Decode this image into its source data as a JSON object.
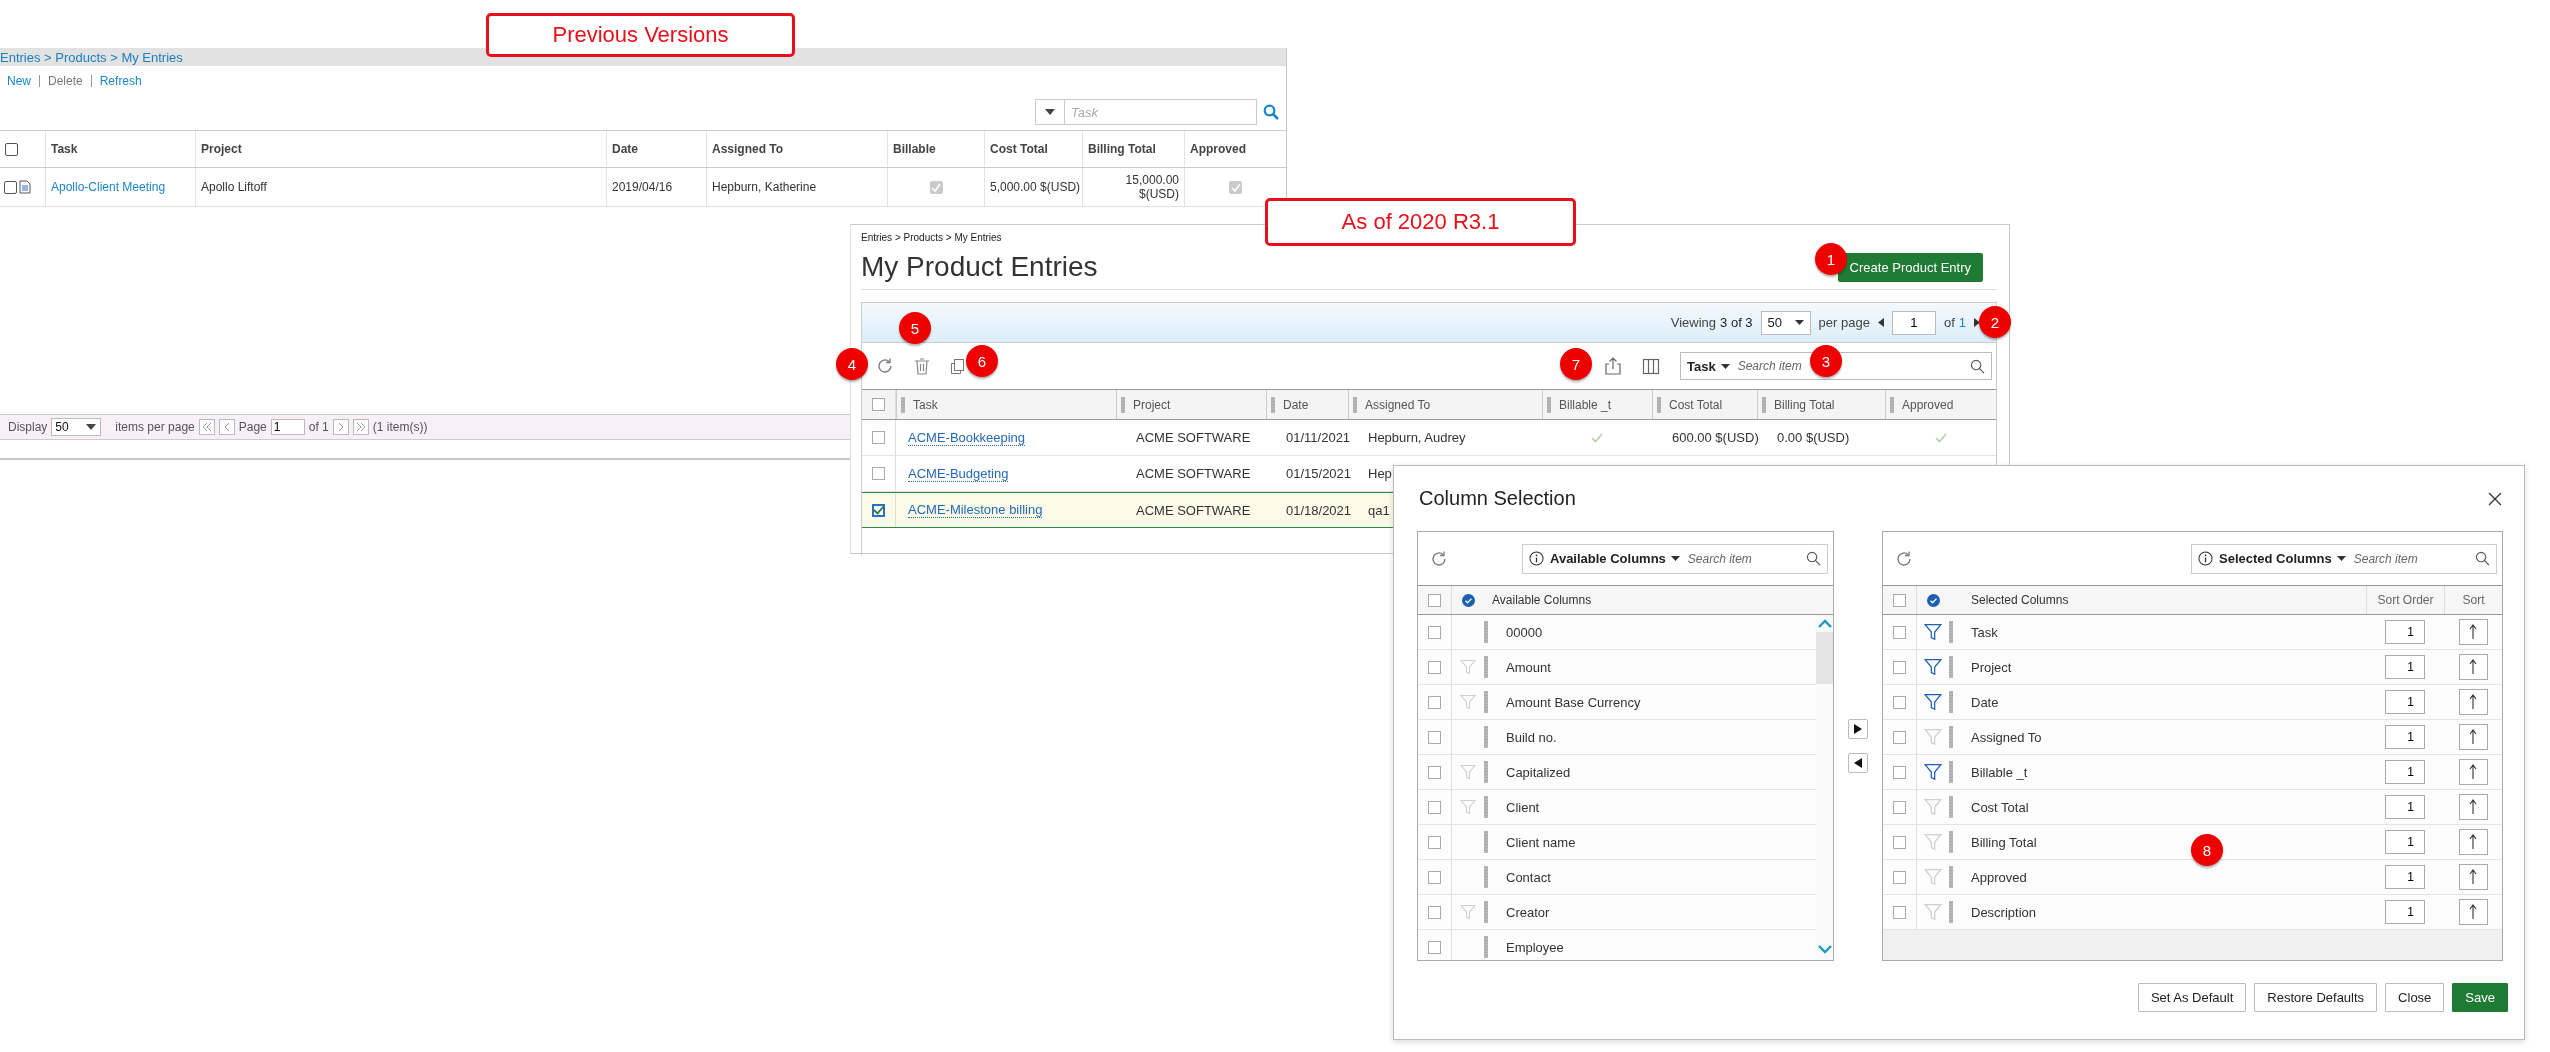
{
  "old_view": {
    "breadcrumb": "Entries > Products > My Entries",
    "actions": [
      {
        "label": "New",
        "disabled": false
      },
      {
        "label": "Delete",
        "disabled": true
      },
      {
        "label": "Refresh",
        "disabled": false
      }
    ],
    "search": {
      "placeholder": "Task"
    },
    "table": {
      "header_checked": false,
      "columns": [
        "Task",
        "Project",
        "Date",
        "Assigned To",
        "Billable",
        "Cost Total",
        "Billing Total",
        "Approved"
      ],
      "rows": [
        {
          "checked": false,
          "task": "Apollo-Client Meeting",
          "project": "Apollo Liftoff",
          "date": "2019/04/16",
          "assigned_to": "Hepburn, Katherine",
          "billable": true,
          "cost_total": "5,000.00 $(USD)",
          "billing_total": "15,000.00 $(USD)",
          "approved": true
        }
      ]
    },
    "footer": {
      "display": "Display",
      "page_size": "50",
      "items_per_page": "items per page",
      "page_label": "Page",
      "page": "1",
      "of": "of 1",
      "count": "(1 item(s))"
    }
  },
  "new_view": {
    "breadcrumb": "Entries > Products > My Entries",
    "title": "My Product Entries",
    "create_button": "Create Product Entry",
    "pager": {
      "viewing": "Viewing",
      "range": "3 of 3",
      "page_size": "50",
      "per_page": "per page",
      "page": "1",
      "of": "of",
      "total": "1"
    },
    "search": {
      "filter": "Task",
      "placeholder": "Search item"
    },
    "table": {
      "header_checked": false,
      "columns": [
        "Task",
        "Project",
        "Date",
        "Assigned To",
        "Billable _t",
        "Cost Total",
        "Billing Total",
        "Approved"
      ],
      "rows": [
        {
          "selected": false,
          "task": "ACME-Bookkeeping",
          "project": "ACME SOFTWARE",
          "date": "01/11/2021",
          "assigned_to": "Hepburn, Audrey",
          "billable": true,
          "cost_total": "600.00 $(USD)",
          "billing_total": "0.00 $(USD)",
          "approved": true
        },
        {
          "selected": false,
          "task": "ACME-Budgeting",
          "project": "ACME SOFTWARE",
          "date": "01/15/2021",
          "assigned_to": "Hep"
        },
        {
          "selected": true,
          "task": "ACME-Milestone billing",
          "project": "ACME SOFTWARE",
          "date": "01/18/2021",
          "assigned_to": "qa1"
        }
      ]
    }
  },
  "column_selection": {
    "title": "Column Selection",
    "available": {
      "filter": "Available Columns",
      "placeholder": "Search item",
      "header_checked": false,
      "header": "Available Columns",
      "items": [
        {
          "label": "00000",
          "checked": false,
          "filterable": false
        },
        {
          "label": "Amount",
          "checked": false,
          "filterable": true
        },
        {
          "label": "Amount Base Currency",
          "checked": false,
          "filterable": true
        },
        {
          "label": "Build no.",
          "checked": false,
          "filterable": false
        },
        {
          "label": "Capitalized",
          "checked": false,
          "filterable": true
        },
        {
          "label": "Client",
          "checked": false,
          "filterable": true
        },
        {
          "label": "Client name",
          "checked": false,
          "filterable": false
        },
        {
          "label": "Contact",
          "checked": false,
          "filterable": false
        },
        {
          "label": "Creator",
          "checked": false,
          "filterable": true
        },
        {
          "label": "Employee",
          "checked": false,
          "filterable": false
        }
      ]
    },
    "selected": {
      "filter": "Selected Columns",
      "placeholder": "Search item",
      "header_checked": false,
      "header": "Selected Columns",
      "sort_order_header": "Sort Order",
      "sort_header": "Sort",
      "items": [
        {
          "label": "Task",
          "checked": false,
          "filter_active": true,
          "sort_order": "1"
        },
        {
          "label": "Project",
          "checked": false,
          "filter_active": true,
          "sort_order": "1"
        },
        {
          "label": "Date",
          "checked": false,
          "filter_active": true,
          "sort_order": "1"
        },
        {
          "label": "Assigned To",
          "checked": false,
          "filter_active": false,
          "sort_order": "1"
        },
        {
          "label": "Billable _t",
          "checked": false,
          "filter_active": true,
          "sort_order": "1"
        },
        {
          "label": "Cost Total",
          "checked": false,
          "filter_active": false,
          "sort_order": "1"
        },
        {
          "label": "Billing Total",
          "checked": false,
          "filter_active": false,
          "sort_order": "1"
        },
        {
          "label": "Approved",
          "checked": false,
          "filter_active": false,
          "sort_order": "1"
        },
        {
          "label": "Description",
          "checked": false,
          "filter_active": false,
          "sort_order": "1"
        }
      ]
    },
    "buttons": [
      {
        "label": "Set As Default",
        "kind": "default"
      },
      {
        "label": "Restore Defaults",
        "kind": "default"
      },
      {
        "label": "Close",
        "kind": "default"
      },
      {
        "label": "Save",
        "kind": "primary"
      }
    ]
  },
  "callouts": [
    {
      "label": "Previous Versions"
    },
    {
      "label": "As of 2020 R3.1"
    }
  ],
  "badges": [
    {
      "label": "1"
    },
    {
      "label": "5"
    },
    {
      "label": "2"
    },
    {
      "label": "4"
    },
    {
      "label": "6"
    },
    {
      "label": "7"
    },
    {
      "label": "3"
    },
    {
      "label": "8"
    }
  ]
}
